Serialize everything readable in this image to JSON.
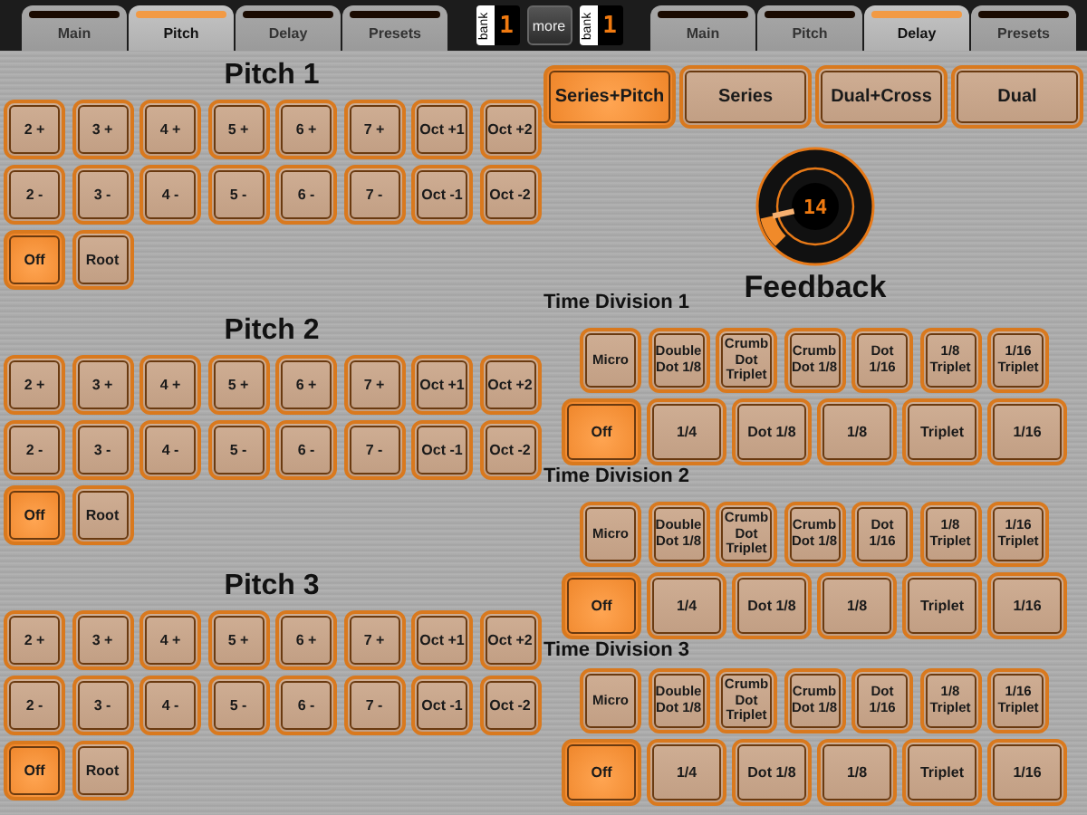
{
  "left_tabs": [
    {
      "label": "Main",
      "selected": false
    },
    {
      "label": "Pitch",
      "selected": true
    },
    {
      "label": "Delay",
      "selected": false
    },
    {
      "label": "Presets",
      "selected": false
    }
  ],
  "bank_left": {
    "label": "bank",
    "value": "1"
  },
  "more_button": {
    "label": "more"
  },
  "bank_right": {
    "label": "bank",
    "value": "1"
  },
  "right_tabs": [
    {
      "label": "Main",
      "selected": false
    },
    {
      "label": "Pitch",
      "selected": false
    },
    {
      "label": "Delay",
      "selected": true
    },
    {
      "label": "Presets",
      "selected": false
    }
  ],
  "pitch_sections": [
    {
      "title": "Pitch 1",
      "buttons": [
        {
          "label": "2 +",
          "selected": false
        },
        {
          "label": "3 +",
          "selected": false
        },
        {
          "label": "4 +",
          "selected": false
        },
        {
          "label": "5 +",
          "selected": false
        },
        {
          "label": "6 +",
          "selected": false
        },
        {
          "label": "7 +",
          "selected": false
        },
        {
          "label": "Oct +1",
          "selected": false
        },
        {
          "label": "Oct +2",
          "selected": false
        },
        {
          "label": "2 -",
          "selected": false
        },
        {
          "label": "3 -",
          "selected": false
        },
        {
          "label": "4 -",
          "selected": false
        },
        {
          "label": "5 -",
          "selected": false
        },
        {
          "label": "6 -",
          "selected": false
        },
        {
          "label": "7 -",
          "selected": false
        },
        {
          "label": "Oct -1",
          "selected": false
        },
        {
          "label": "Oct -2",
          "selected": false
        },
        {
          "label": "Off",
          "selected": true
        },
        {
          "label": "Root",
          "selected": false
        }
      ]
    },
    {
      "title": "Pitch 2",
      "buttons": [
        {
          "label": "2 +",
          "selected": false
        },
        {
          "label": "3 +",
          "selected": false
        },
        {
          "label": "4 +",
          "selected": false
        },
        {
          "label": "5 +",
          "selected": false
        },
        {
          "label": "6 +",
          "selected": false
        },
        {
          "label": "7 +",
          "selected": false
        },
        {
          "label": "Oct +1",
          "selected": false
        },
        {
          "label": "Oct +2",
          "selected": false
        },
        {
          "label": "2 -",
          "selected": false
        },
        {
          "label": "3 -",
          "selected": false
        },
        {
          "label": "4 -",
          "selected": false
        },
        {
          "label": "5 -",
          "selected": false
        },
        {
          "label": "6 -",
          "selected": false
        },
        {
          "label": "7 -",
          "selected": false
        },
        {
          "label": "Oct -1",
          "selected": false
        },
        {
          "label": "Oct -2",
          "selected": false
        },
        {
          "label": "Off",
          "selected": true
        },
        {
          "label": "Root",
          "selected": false
        }
      ]
    },
    {
      "title": "Pitch 3",
      "buttons": [
        {
          "label": "2 +",
          "selected": false
        },
        {
          "label": "3 +",
          "selected": false
        },
        {
          "label": "4 +",
          "selected": false
        },
        {
          "label": "5 +",
          "selected": false
        },
        {
          "label": "6 +",
          "selected": false
        },
        {
          "label": "7 +",
          "selected": false
        },
        {
          "label": "Oct +1",
          "selected": false
        },
        {
          "label": "Oct +2",
          "selected": false
        },
        {
          "label": "2 -",
          "selected": false
        },
        {
          "label": "3 -",
          "selected": false
        },
        {
          "label": "4 -",
          "selected": false
        },
        {
          "label": "5 -",
          "selected": false
        },
        {
          "label": "6 -",
          "selected": false
        },
        {
          "label": "7 -",
          "selected": false
        },
        {
          "label": "Oct -1",
          "selected": false
        },
        {
          "label": "Oct -2",
          "selected": false
        },
        {
          "label": "Off",
          "selected": true
        },
        {
          "label": "Root",
          "selected": false
        }
      ]
    }
  ],
  "modes": [
    {
      "label": "Series+Pitch",
      "selected": true
    },
    {
      "label": "Series",
      "selected": false
    },
    {
      "label": "Dual+Cross",
      "selected": false
    },
    {
      "label": "Dual",
      "selected": false
    }
  ],
  "feedback": {
    "value": "14",
    "label": "Feedback"
  },
  "time_divisions": [
    {
      "title": "Time Division 1",
      "top_row": [
        {
          "label": "Micro",
          "selected": false
        },
        {
          "label": "Double Dot 1/8",
          "selected": false
        },
        {
          "label": "Crumb Dot Triplet",
          "selected": false
        },
        {
          "label": "Crumb Dot 1/8",
          "selected": false
        },
        {
          "label": "Dot 1/16",
          "selected": false
        },
        {
          "label": "1/8 Triplet",
          "selected": false
        },
        {
          "label": "1/16 Triplet",
          "selected": false
        }
      ],
      "bottom_row": [
        {
          "label": "Off",
          "selected": true
        },
        {
          "label": "1/4",
          "selected": false
        },
        {
          "label": "Dot 1/8",
          "selected": false
        },
        {
          "label": "1/8",
          "selected": false
        },
        {
          "label": "Triplet",
          "selected": false
        },
        {
          "label": "1/16",
          "selected": false
        }
      ]
    },
    {
      "title": "Time Division 2",
      "top_row": [
        {
          "label": "Micro",
          "selected": false
        },
        {
          "label": "Double Dot 1/8",
          "selected": false
        },
        {
          "label": "Crumb Dot Triplet",
          "selected": false
        },
        {
          "label": "Crumb Dot 1/8",
          "selected": false
        },
        {
          "label": "Dot 1/16",
          "selected": false
        },
        {
          "label": "1/8 Triplet",
          "selected": false
        },
        {
          "label": "1/16 Triplet",
          "selected": false
        }
      ],
      "bottom_row": [
        {
          "label": "Off",
          "selected": true
        },
        {
          "label": "1/4",
          "selected": false
        },
        {
          "label": "Dot 1/8",
          "selected": false
        },
        {
          "label": "1/8",
          "selected": false
        },
        {
          "label": "Triplet",
          "selected": false
        },
        {
          "label": "1/16",
          "selected": false
        }
      ]
    },
    {
      "title": "Time Division 3",
      "top_row": [
        {
          "label": "Micro",
          "selected": false
        },
        {
          "label": "Double Dot 1/8",
          "selected": false
        },
        {
          "label": "Crumb Dot Triplet",
          "selected": false
        },
        {
          "label": "Crumb Dot 1/8",
          "selected": false
        },
        {
          "label": "Dot 1/16",
          "selected": false
        },
        {
          "label": "1/8 Triplet",
          "selected": false
        },
        {
          "label": "1/16 Triplet",
          "selected": false
        }
      ],
      "bottom_row": [
        {
          "label": "Off",
          "selected": true
        },
        {
          "label": "1/4",
          "selected": false
        },
        {
          "label": "Dot 1/8",
          "selected": false
        },
        {
          "label": "1/8",
          "selected": false
        },
        {
          "label": "Triplet",
          "selected": false
        },
        {
          "label": "1/16",
          "selected": false
        }
      ]
    }
  ]
}
